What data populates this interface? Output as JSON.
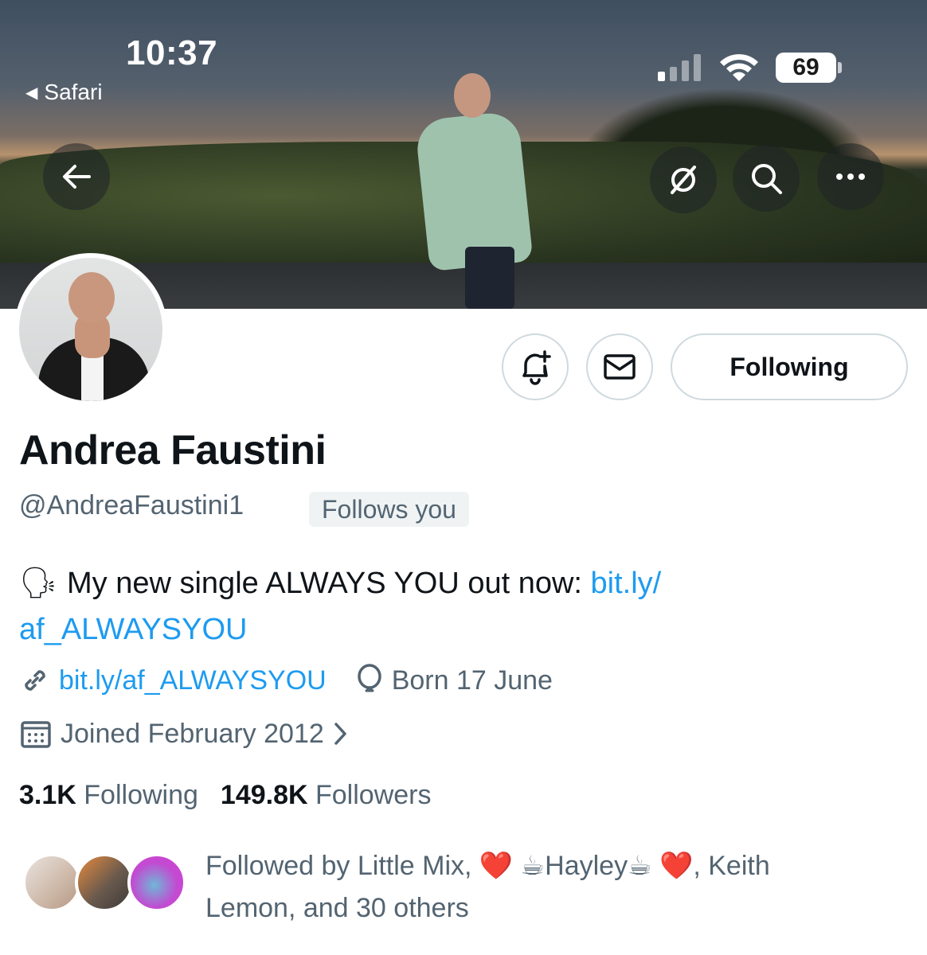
{
  "status_bar": {
    "time": "10:37",
    "back_app": "Safari",
    "battery": "69"
  },
  "profile": {
    "display_name": "Andrea Faustini",
    "handle": "@AndreaFaustini1",
    "follows_you_badge": "Follows you",
    "bio_emoji": "🗣",
    "bio_text": "My new single ALWAYS YOU out now: ",
    "bio_link_part1": "bit.ly/",
    "bio_link_part2": "af_ALWAYSYOU",
    "website": "bit.ly/af_ALWAYSYOU",
    "birthday": "Born 17 June",
    "joined": "Joined February 2012",
    "following_count": "3.1K",
    "following_label": "Following",
    "followers_count": "149.8K",
    "followers_label": "Followers",
    "followed_by_line1": "Followed by Little Mix, ❤️ ☕Hayley☕ ❤️, Keith",
    "followed_by_line2": "Lemon, and 30 others"
  },
  "actions": {
    "following_button": "Following"
  },
  "icons": {
    "back": "back-arrow-icon",
    "hide": "slash-circle-icon",
    "search": "search-icon",
    "more": "more-icon",
    "notify": "bell-plus-icon",
    "message": "envelope-icon",
    "link": "link-icon",
    "birthday": "balloon-icon",
    "calendar": "calendar-icon"
  },
  "colors": {
    "accent": "#1d9bf0",
    "text_primary": "#0f1419",
    "text_secondary": "#536471",
    "border": "#cfd9de"
  }
}
